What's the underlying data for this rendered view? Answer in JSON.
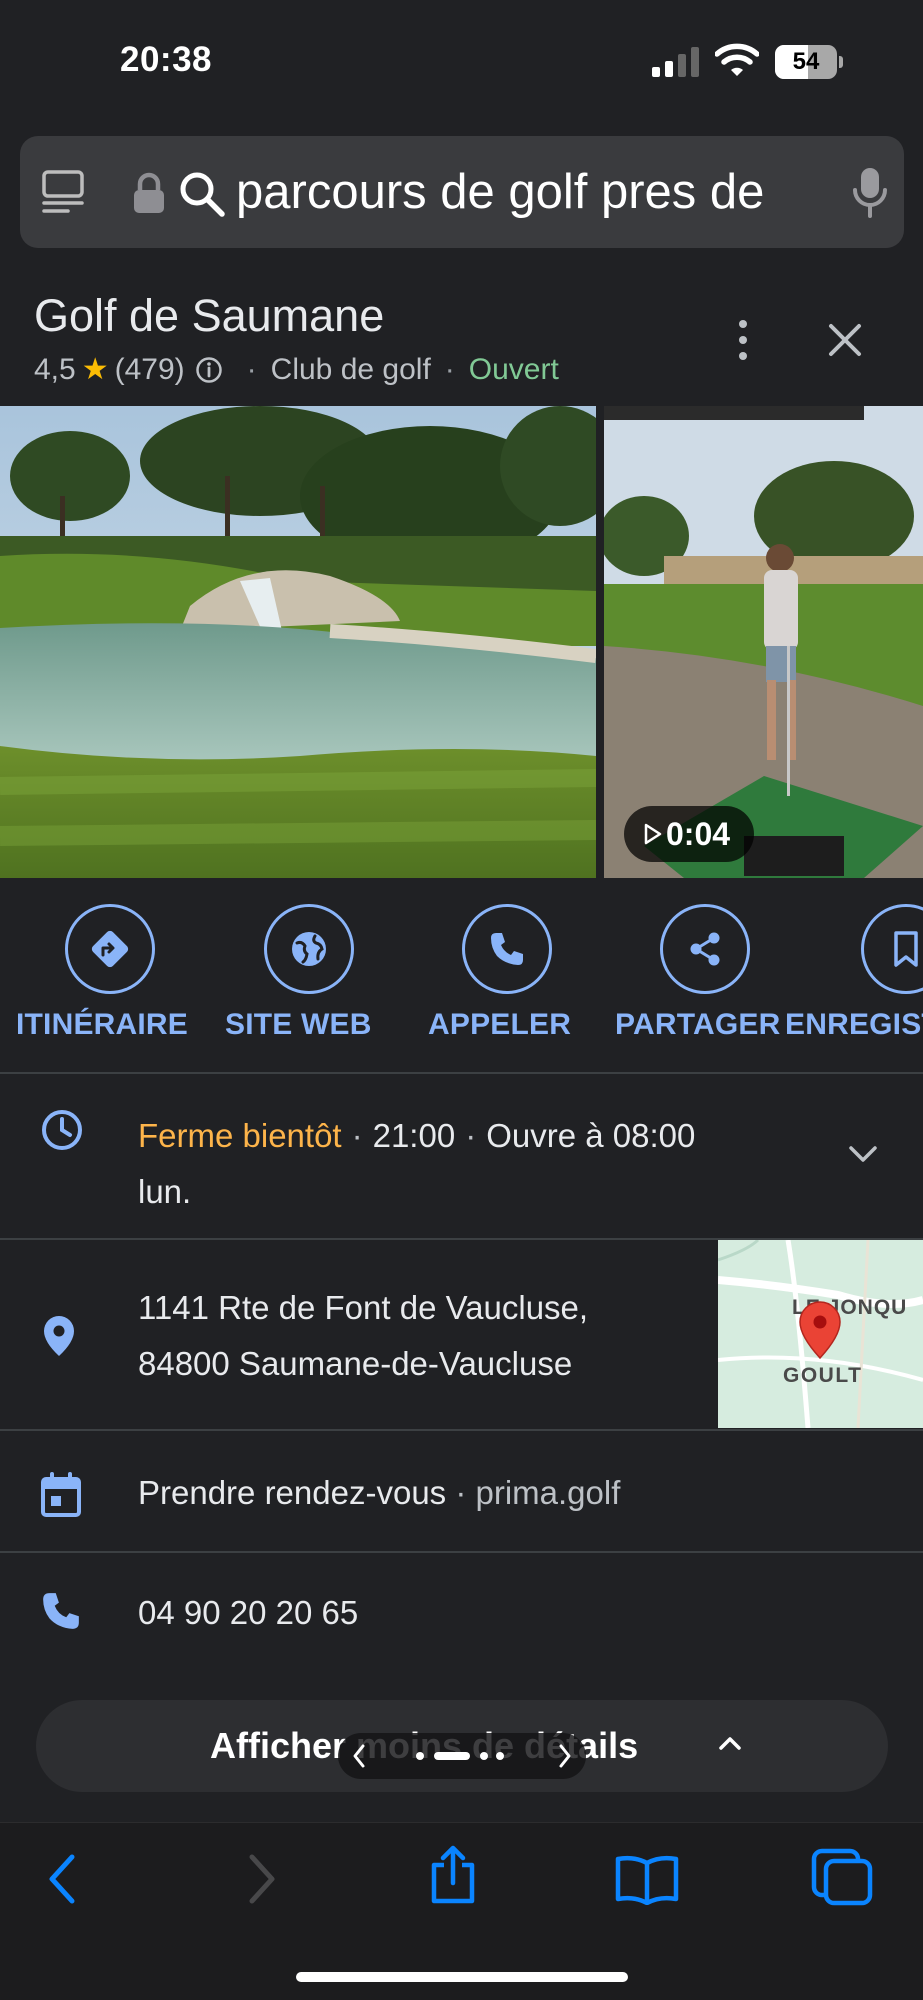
{
  "status_bar": {
    "time": "20:38",
    "battery": "54",
    "battery_level": 0.54
  },
  "url_bar": {
    "query": "parcours de golf pres de"
  },
  "place": {
    "name": "Golf de Saumane",
    "rating": "4,5",
    "review_count": "(479)",
    "category": "Club de golf",
    "open_status": "Ouvert"
  },
  "photos": {
    "video_duration": "0:04"
  },
  "actions": [
    {
      "label": "ITINÉRAIRE",
      "icon": "directions-icon"
    },
    {
      "label": "SITE WEB",
      "icon": "globe-icon"
    },
    {
      "label": "APPELER",
      "icon": "phone-icon"
    },
    {
      "label": "PARTAGER",
      "icon": "share-icon"
    },
    {
      "label": "ENREGISTRER",
      "icon": "bookmark-icon"
    }
  ],
  "hours": {
    "status": "Ferme bientôt",
    "closes": "21:00",
    "reopens": "Ouvre à 08:00",
    "day": "lun."
  },
  "address": {
    "line1": "1141 Rte de Font de Vaucluse,",
    "line2": "84800 Saumane-de-Vaucluse",
    "map_label_top": "LE JONQU",
    "map_label_town": "GOULT"
  },
  "booking": {
    "label": "Prendre rendez-vous",
    "site": "prima.golf"
  },
  "phone": {
    "number": "04 90 20 20 65"
  },
  "details_toggle": {
    "label": "Afficher moins de détails"
  },
  "colors": {
    "background": "#202124",
    "accent_blue": "#8ab4f8",
    "open_green": "#81c995",
    "warning_orange": "#fdb44a",
    "star_yellow": "#fbbc04",
    "safari_blue": "#0a84ff"
  }
}
